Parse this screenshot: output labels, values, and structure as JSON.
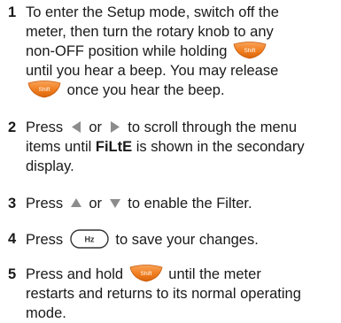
{
  "steps": [
    {
      "number": "1",
      "line1": "To enter the Setup mode, switch off the",
      "line2": "meter, then turn the rotary knob to any",
      "line3_pre": "non-OFF position while holding",
      "line4": "until you hear a beep. You may release",
      "line5_post": "once you hear the beep."
    },
    {
      "number": "2",
      "line1_pre": "Press",
      "line1_mid": "or",
      "line1_post": "to scroll through the menu",
      "line2_pre": "items until",
      "line2_bold": "FiLtE",
      "line2_post": "is shown in the secondary",
      "line3": "display."
    },
    {
      "number": "3",
      "line1_pre": "Press",
      "line1_mid": "or",
      "line1_post": "to enable the Filter."
    },
    {
      "number": "4",
      "line1_pre": "Press",
      "line1_post": "to save your changes."
    },
    {
      "number": "5",
      "line1_pre": "Press and hold",
      "line1_post": "until the meter",
      "line2": "restarts and returns to its normal operating",
      "line3": "mode."
    }
  ],
  "keys": {
    "shift_label": "Shift",
    "hz_label": "Hz",
    "shift_color": "#f07d1e",
    "arrow_color": "#8c8c8c"
  }
}
